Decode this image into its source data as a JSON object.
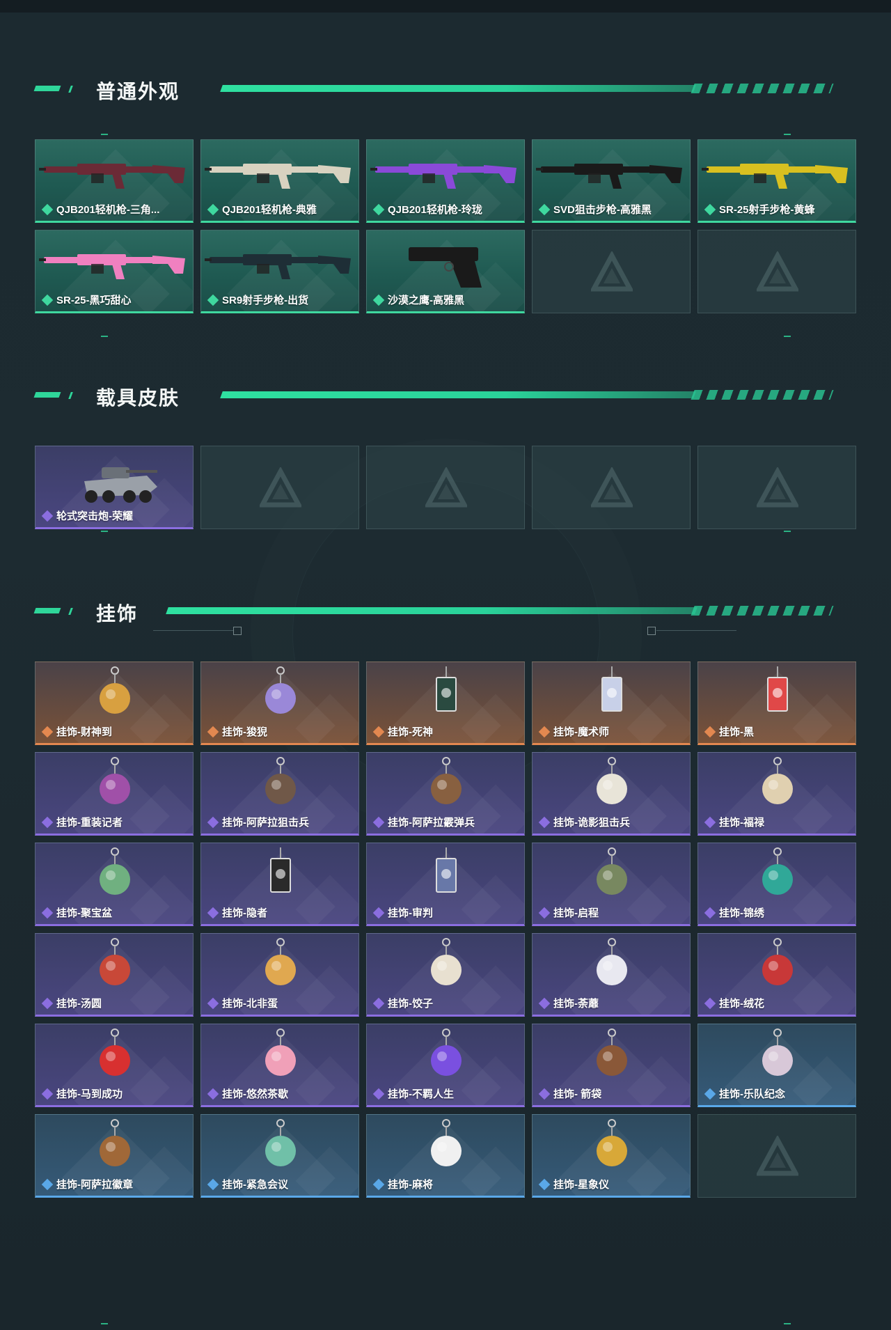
{
  "sections": [
    {
      "title": "普通外观",
      "items": [
        {
          "label": "QJB201轻机枪-三角...",
          "rarity": "green",
          "kind": "rifle",
          "color": "#6b2a36"
        },
        {
          "label": "QJB201轻机枪-典雅",
          "rarity": "green",
          "kind": "rifle",
          "color": "#d8d2c0"
        },
        {
          "label": "QJB201轻机枪-玲珑",
          "rarity": "green",
          "kind": "rifle",
          "color": "#8a4ad8"
        },
        {
          "label": "SVD狙击步枪-高雅黑",
          "rarity": "green",
          "kind": "rifle",
          "color": "#1a1a1a"
        },
        {
          "label": "SR-25射手步枪-黄蜂",
          "rarity": "green",
          "kind": "rifle",
          "color": "#d8c020"
        },
        {
          "label": "SR-25-黑巧甜心",
          "rarity": "green",
          "kind": "rifle",
          "color": "#f080c0"
        },
        {
          "label": "SR9射手步枪-出货",
          "rarity": "green",
          "kind": "rifle",
          "color": "#1e2e36"
        },
        {
          "label": "沙漠之鹰-高雅黑",
          "rarity": "green",
          "kind": "pistol",
          "color": "#1a1a1a"
        },
        {
          "label": "",
          "rarity": "empty"
        },
        {
          "label": "",
          "rarity": "empty"
        }
      ]
    },
    {
      "title": "载具皮肤",
      "items": [
        {
          "label": "轮式突击炮-荣耀",
          "rarity": "purple",
          "kind": "vehicle",
          "color": "#9aa0a8"
        },
        {
          "label": "",
          "rarity": "empty"
        },
        {
          "label": "",
          "rarity": "empty"
        },
        {
          "label": "",
          "rarity": "empty"
        },
        {
          "label": "",
          "rarity": "empty"
        }
      ]
    },
    {
      "title": "挂饰",
      "items": [
        {
          "label": "挂饰-财神到",
          "rarity": "orange",
          "kind": "charm",
          "color": "#d8a040"
        },
        {
          "label": "挂饰-狻猊",
          "rarity": "orange",
          "kind": "charm",
          "color": "#9a88d8"
        },
        {
          "label": "挂饰-死神",
          "rarity": "orange",
          "kind": "card",
          "color": "#2a4a40"
        },
        {
          "label": "挂饰-魔术师",
          "rarity": "orange",
          "kind": "card",
          "color": "#c8d0e8"
        },
        {
          "label": "挂饰-黑",
          "rarity": "orange",
          "kind": "card",
          "color": "#e04848"
        },
        {
          "label": "挂饰-重装记者",
          "rarity": "purple",
          "kind": "charm",
          "color": "#a050a8"
        },
        {
          "label": "挂饰-阿萨拉狙击兵",
          "rarity": "purple",
          "kind": "charm",
          "color": "#705848"
        },
        {
          "label": "挂饰-阿萨拉霰弹兵",
          "rarity": "purple",
          "kind": "charm",
          "color": "#886040"
        },
        {
          "label": "挂饰-诡影狙击兵",
          "rarity": "purple",
          "kind": "charm",
          "color": "#e8e4d8"
        },
        {
          "label": "挂饰-福禄",
          "rarity": "purple",
          "kind": "charm",
          "color": "#e0d0b0"
        },
        {
          "label": "挂饰-聚宝盆",
          "rarity": "purple",
          "kind": "charm",
          "color": "#70b080"
        },
        {
          "label": "挂饰-隐者",
          "rarity": "purple",
          "kind": "card",
          "color": "#2a2a2a"
        },
        {
          "label": "挂饰-审判",
          "rarity": "purple",
          "kind": "card",
          "color": "#6878a8"
        },
        {
          "label": "挂饰-启程",
          "rarity": "purple",
          "kind": "charm",
          "color": "#788860"
        },
        {
          "label": "挂饰-锦绣",
          "rarity": "purple",
          "kind": "charm",
          "color": "#30a898"
        },
        {
          "label": "挂饰-汤圆",
          "rarity": "purple",
          "kind": "charm",
          "color": "#c84838"
        },
        {
          "label": "挂饰-北非蛋",
          "rarity": "purple",
          "kind": "charm",
          "color": "#e0a850"
        },
        {
          "label": "挂饰-饺子",
          "rarity": "purple",
          "kind": "charm",
          "color": "#e8e0d0"
        },
        {
          "label": "挂饰-荼蘼",
          "rarity": "purple",
          "kind": "charm",
          "color": "#e8e8f0"
        },
        {
          "label": "挂饰-绒花",
          "rarity": "purple",
          "kind": "charm",
          "color": "#c83838"
        },
        {
          "label": "挂饰-马到成功",
          "rarity": "purple",
          "kind": "charm",
          "color": "#d83030"
        },
        {
          "label": "挂饰-悠然茶歇",
          "rarity": "purple",
          "kind": "charm",
          "color": "#f0a0b8"
        },
        {
          "label": "挂饰-不羁人生",
          "rarity": "purple",
          "kind": "charm",
          "color": "#7a50e0"
        },
        {
          "label": "挂饰- 箭袋",
          "rarity": "purple",
          "kind": "charm",
          "color": "#8a5838"
        },
        {
          "label": "挂饰-乐队纪念",
          "rarity": "blue",
          "kind": "charm",
          "color": "#d8c8d8"
        },
        {
          "label": "挂饰-阿萨拉徽章",
          "rarity": "blue",
          "kind": "charm",
          "color": "#a06838"
        },
        {
          "label": "挂饰-紧急会议",
          "rarity": "blue",
          "kind": "charm",
          "color": "#70c0a8"
        },
        {
          "label": "挂饰-麻将",
          "rarity": "blue",
          "kind": "charm",
          "color": "#f0f0f0"
        },
        {
          "label": "挂饰-星象仪",
          "rarity": "blue",
          "kind": "charm",
          "color": "#d8a838"
        },
        {
          "label": "",
          "rarity": "empty"
        }
      ]
    }
  ],
  "rarity_colors": {
    "green": "#3fd89f",
    "purple": "#8b6ee0",
    "orange": "#e38850",
    "blue": "#5aa8e8"
  },
  "accent": "#2fd69a"
}
